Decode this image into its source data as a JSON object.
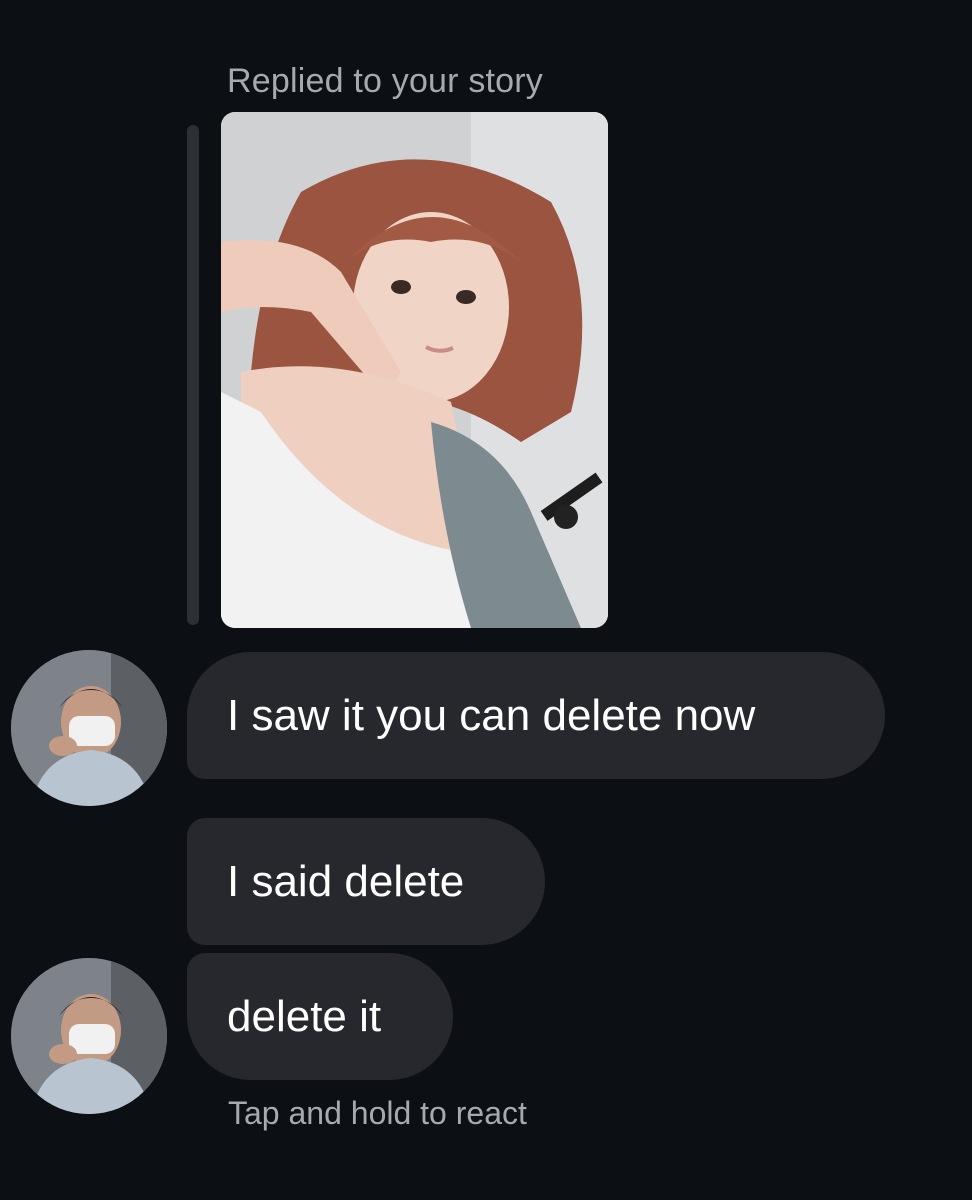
{
  "reply": {
    "label": "Replied to your story"
  },
  "messages": [
    {
      "text": "I saw it you can delete now"
    },
    {
      "text": "I said delete"
    },
    {
      "text": "delete it"
    }
  ],
  "footer": {
    "hint": "Tap and hold to react"
  },
  "colors": {
    "background": "#0c0f14",
    "bubble": "#26282d",
    "muted_text": "#a6a9ae",
    "reply_bar": "#2b2f36"
  },
  "icons": {
    "story": "story-thumbnail-image",
    "avatar": "sender-avatar-image"
  }
}
